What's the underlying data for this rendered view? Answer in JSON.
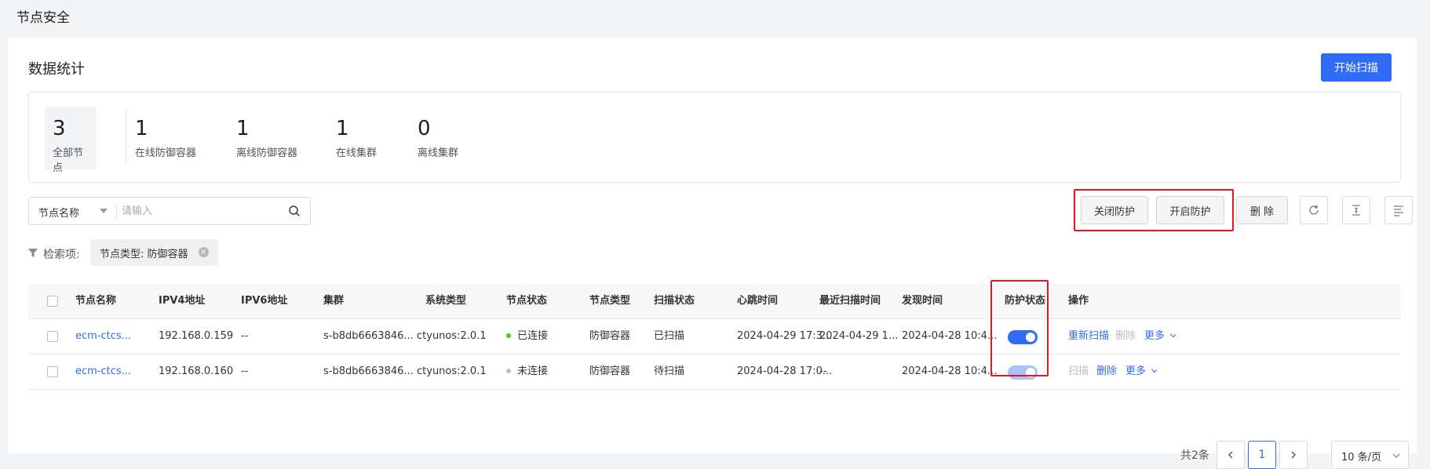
{
  "page": {
    "title": "节点安全"
  },
  "section": {
    "title": "数据统计",
    "scan_button": "开始扫描"
  },
  "stats": [
    {
      "value": "3",
      "label": "全部节点"
    },
    {
      "value": "1",
      "label": "在线防御容器"
    },
    {
      "value": "1",
      "label": "离线防御容器"
    },
    {
      "value": "1",
      "label": "在线集群"
    },
    {
      "value": "0",
      "label": "离线集群"
    }
  ],
  "search": {
    "field": "节点名称",
    "placeholder": "请输入"
  },
  "toolbar": {
    "disable_protection": "关闭防护",
    "enable_protection": "开启防护",
    "delete": "删 除"
  },
  "filter": {
    "label": "检索项:",
    "tag": "节点类型: 防御容器"
  },
  "table": {
    "headers": [
      "节点名称",
      "IPV4地址",
      "IPV6地址",
      "集群",
      "系统类型",
      "节点状态",
      "节点类型",
      "扫描状态",
      "心跳时间",
      "最近扫描时间",
      "发现时间",
      "防护状态",
      "操作"
    ],
    "rows": [
      {
        "name": "ecm-ctcs...",
        "ipv4": "192.168.0.159",
        "ipv6": "--",
        "cluster": "s-b8db6663846...",
        "os": "ctyunos:2.0.1",
        "status": "已连接",
        "status_color": "#52c41a",
        "type": "防御容器",
        "scan": "已扫描",
        "heartbeat": "2024-04-29 17:3...",
        "last_scan": "2024-04-29 1...",
        "found": "2024-04-28 10:4...",
        "protected": true,
        "toggle_color": "#2f6bf5",
        "action1": "重新扫描",
        "action2": "删除",
        "action3": "更多"
      },
      {
        "name": "ecm-ctcs...",
        "ipv4": "192.168.0.160",
        "ipv6": "--",
        "cluster": "s-b8db6663846...",
        "os": "ctyunos:2.0.1",
        "status": "未连接",
        "status_color": "#bfbfbf",
        "type": "防御容器",
        "scan": "待扫描",
        "heartbeat": "2024-04-28 17:0...",
        "last_scan": "--",
        "found": "2024-04-28 10:4...",
        "protected": true,
        "toggle_color": "#a9c3f7",
        "action1": "扫描",
        "action2": "删除",
        "action3": "更多"
      }
    ]
  },
  "pagination": {
    "total": "共2条",
    "current": "1",
    "page_size": "10 条/页"
  },
  "colors": {
    "primary": "#2f6bf5",
    "highlight": "#e8151b"
  }
}
